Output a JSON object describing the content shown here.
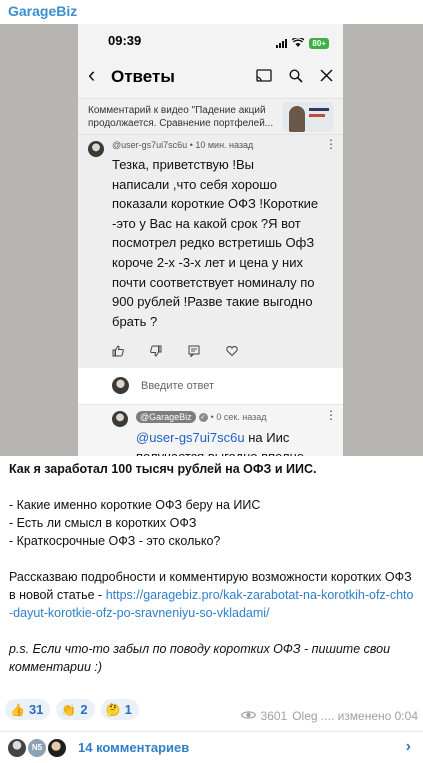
{
  "channel": {
    "name": "GarageBiz"
  },
  "screenshot": {
    "status_bar": {
      "time": "09:39",
      "battery": "80+"
    },
    "app_bar": {
      "title": "Ответы"
    },
    "video_ref": {
      "text": "Комментарий к видео \"Падение акций продолжается. Сравнение портфелей..."
    },
    "comment": {
      "user": "@user-gs7ui7sc6u",
      "time": "• 10 мин. назад",
      "body": "Тезка, приветствую !Вы\nнаписали ,что себя хорошо\nпоказали короткие ОФЗ !Короткие\n-это у Вас на какой срок ?Я вот\nпосмотрел редко встретишь ОфЗ\nкороче 2-х -3-х лет и цена у них\nпочти соответствует номиналу по\n900 рублей !Разве такие выгодно\nбрать ?"
    },
    "reply_input": {
      "placeholder": "Введите ответ"
    },
    "reply": {
      "user": "@GarageBiz",
      "check": "✓",
      "time": "• 0 сек. назад",
      "mention": "@user-gs7ui7sc6u",
      "body": " на Иис получается выгодно вполне"
    }
  },
  "post": {
    "title": "Как я заработал 100 тысяч рублей на ОФЗ и ИИС.",
    "bullets": [
      "- Какие именно короткие ОФЗ беру на ИИС",
      "- Есть ли смысл в коротких ОФЗ",
      "- Краткосрочные ОФЗ - это сколько?"
    ],
    "paragraph": "Рассказваю подробности и комментирую возможности коротких ОФЗ в новой статье - ",
    "link": "https://garagebiz.pro/kak-zarabotat-na-korotkih-ofz-chto-dayut-korotkie-ofz-po-sravneniyu-so-vkladami/",
    "ps": "p.s. Если что-то забыл по поводу коротких ОФЗ - пишите свои комментарии :)"
  },
  "reactions": [
    {
      "emoji": "👍",
      "count": "31"
    },
    {
      "emoji": "👏",
      "count": "2"
    },
    {
      "emoji": "🤔",
      "count": "1"
    }
  ],
  "meta": {
    "views": "3601",
    "author_edited": "Oleg .... изменено 0:04"
  },
  "comments_bar": {
    "count_label": "14 комментариев",
    "avatar_badge": "N5"
  },
  "colors": {
    "link": "#2f7fc9",
    "mention": "#1c62c4",
    "battery": "#3cb043",
    "reaction_bg": "#eaf1f8"
  }
}
